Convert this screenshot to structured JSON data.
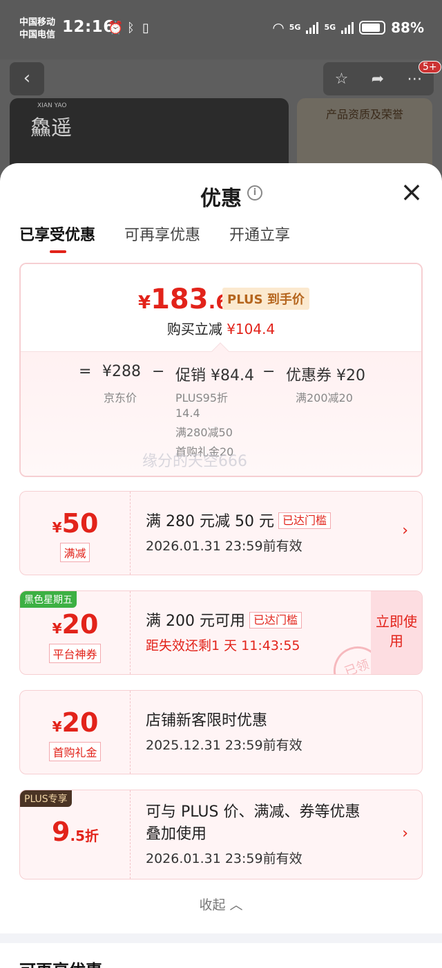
{
  "status": {
    "carrier1": "中国移动",
    "carrier2": "中国电信",
    "time": "12:16",
    "net1": "5G",
    "net2": "5G",
    "battery": "88%"
  },
  "background": {
    "brand": "鱻遥",
    "brand_en": "XIAN YAO",
    "badge": "5+",
    "promo_title": "产品资质及荣誉"
  },
  "sheet": {
    "title": "优惠",
    "tabs": [
      "已享受优惠",
      "可再享优惠",
      "开通立享"
    ]
  },
  "summary": {
    "currency": "¥",
    "final_int": "183",
    "final_dec": ".6",
    "plus_tag": "PLUS 到手价",
    "reduce_label": "购买立减",
    "reduce_value": "¥104.4",
    "eq": "=",
    "base_price": "¥288",
    "minus": "−",
    "promo": "促销 ¥84.4",
    "coupon": "优惠券 ¥20",
    "base_label": "京东价",
    "promo_line1": "PLUS95折",
    "promo_line2": "14.4",
    "promo_line3": "满280减50",
    "promo_line4": "首购礼金20",
    "coupon_label": "满200减20",
    "watermark": "缘分的天空666"
  },
  "cards": [
    {
      "currency": "¥",
      "amount": "50",
      "tag": "满减",
      "title": "满 280 元减 50 元",
      "reach": "已达门槛",
      "expire": "2026.01.31 23:59前有效"
    },
    {
      "corner": "黑色星期五",
      "currency": "¥",
      "amount": "20",
      "tag": "平台神券",
      "title": "满 200 元可用",
      "reach": "已达门槛",
      "expire": "距失效还剩1 天 11:43:55",
      "use": "立即使用",
      "stamp": "已领"
    },
    {
      "currency": "¥",
      "amount": "20",
      "tag": "首购礼金",
      "title": "店铺新客限时优惠",
      "expire": "2025.12.31 23:59前有效"
    },
    {
      "corner": "PLUS专享",
      "amount": "9",
      "suffix": ".5折",
      "title1": "可与 PLUS 价、满减、券等优惠",
      "title2": "叠加使用",
      "expire": "2026.01.31 23:59前有效"
    }
  ],
  "collapse": "收起",
  "next_section": "可再享优惠",
  "colors": {
    "accent": "#e2231a",
    "plus_gold": "#b5651d",
    "black_friday_green": "#3cb043"
  }
}
